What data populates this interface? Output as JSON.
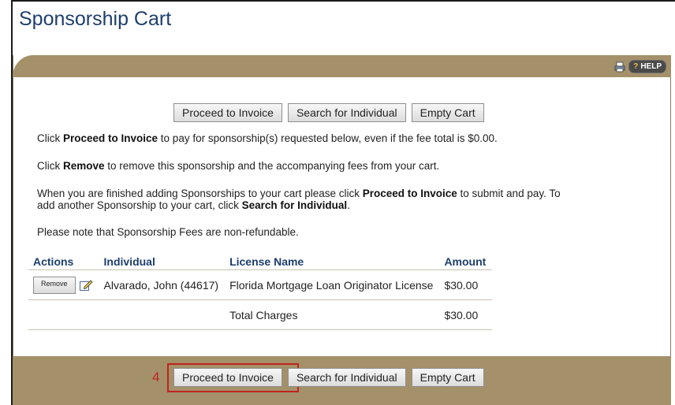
{
  "page": {
    "title": "Sponsorship Cart"
  },
  "header": {
    "help_label": "HELP",
    "help_prefix": "?"
  },
  "actions": {
    "proceed_label": "Proceed to Invoice",
    "search_label": "Search for Individual",
    "empty_label": "Empty Cart"
  },
  "instructions": {
    "p1_pre": "Click ",
    "p1_bold": "Proceed to Invoice",
    "p1_post": " to pay for sponsorship(s) requested below, even if the fee total is $0.00.",
    "p2_pre": "Click ",
    "p2_bold": "Remove",
    "p2_post": " to remove this sponsorship and the accompanying fees from your cart.",
    "p3_a": "When you are finished adding Sponsorships to your cart please click ",
    "p3_b": "Proceed to Invoice",
    "p3_c": " to submit and pay. To",
    "p3_d": "add another Sponsorship to your cart, click ",
    "p3_e": "Search for Individual",
    "p3_f": ".",
    "p4": "Please note that Sponsorship Fees are non-refundable."
  },
  "table": {
    "headers": [
      "Actions",
      "Individual",
      "License Name",
      "Amount"
    ],
    "rows": [
      {
        "remove_label": "Remove",
        "individual": "Alvarado, John (44617)",
        "license_name": "Florida Mortgage Loan Originator License",
        "amount": "$30.00"
      }
    ],
    "total_label": "Total Charges",
    "total_amount": "$30.00"
  },
  "annotation": {
    "step": "4"
  },
  "colors": {
    "panel": "#a4916a",
    "title": "#1d3f6e",
    "highlight": "#c0221f"
  }
}
